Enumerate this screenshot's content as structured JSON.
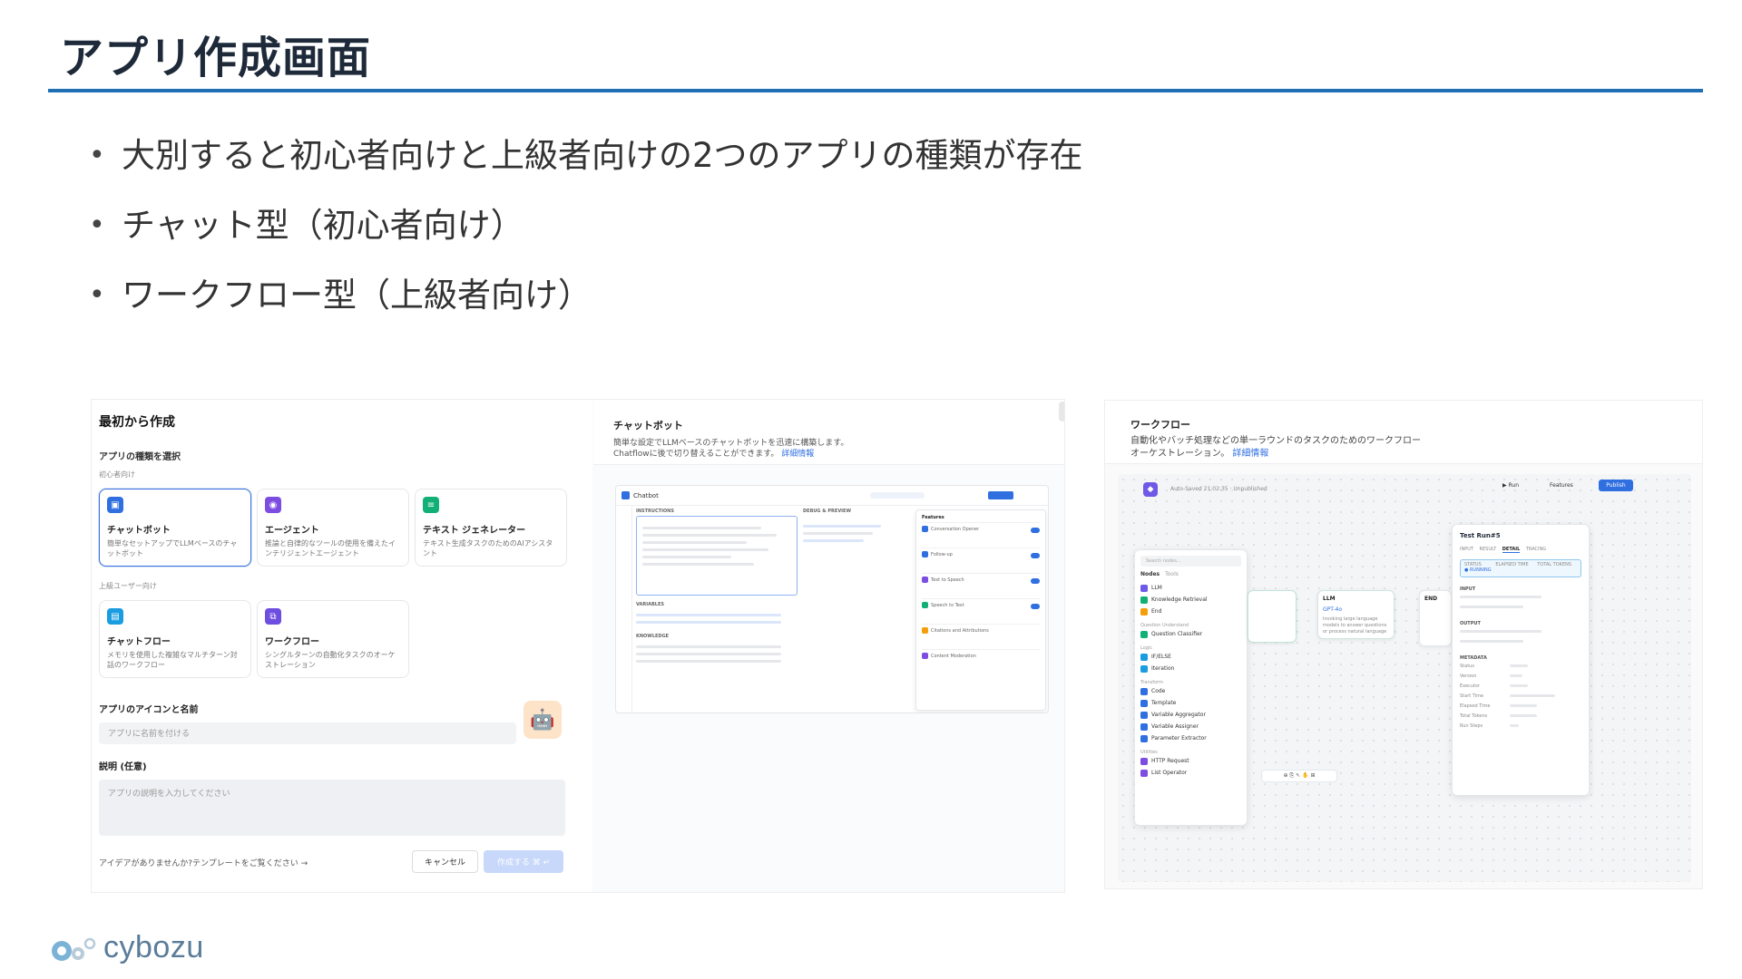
{
  "slide": {
    "title": "アプリ作成画面",
    "bullets": [
      "大別すると初心者向けと上級者向けの2つのアプリの種類が存在",
      "チャット型（初心者向け）",
      "ワークフロー型（上級者向け）"
    ],
    "logo_text": "cybozu",
    "colors": {
      "title_rule": "#1f6fb5",
      "accent": "#2f6fe0"
    }
  },
  "create_panel": {
    "title": "最初から作成",
    "type_label": "アプリの種類を選択",
    "beginner_group": "初心者向け",
    "advanced_group": "上級ユーザー向け",
    "cards": [
      {
        "name": "チャットボット",
        "desc": "簡単なセットアップでLLMベースのチャットボット",
        "icon": "chatbot-icon",
        "color": "#2f6fe0"
      },
      {
        "name": "エージェント",
        "desc": "推論と自律的なツールの使用を備えたインテリジェントエージェント",
        "icon": "agent-icon",
        "color": "#7c4de0"
      },
      {
        "name": "テキスト ジェネレーター",
        "desc": "テキスト生成タスクのためのAIアシスタント",
        "icon": "text-generator-icon",
        "color": "#12b076"
      },
      {
        "name": "チャットフロー",
        "desc": "メモリを使用した複雑なマルチターン対話のワークフロー",
        "icon": "chatflow-icon",
        "color": "#1a9ce0"
      },
      {
        "name": "ワークフロー",
        "desc": "シングルターンの自動化タスクのオーケストレーション",
        "icon": "workflow-icon",
        "color": "#6d4ee0"
      }
    ],
    "icon_name_label": "アプリのアイコンと名前",
    "name_placeholder": "アプリに名前を付ける",
    "desc_label": "説明 (任意)",
    "desc_placeholder": "アプリの説明を入力してください",
    "footer_text": "アイデアがありませんか?テンプレートをご覧ください →",
    "cancel": "キャンセル",
    "create": "作成する ⌘ ↵"
  },
  "chat_preview": {
    "title": "チャットボット",
    "desc_line1": "簡単な設定でLLMベースのチャットボットを迅速に構築します。",
    "desc_line2": "Chatflowに後で切り替えることができます。",
    "link": "詳細情報",
    "mock_app_name": "Chatbot",
    "instructions": "INSTRUCTIONS",
    "variables": "VARIABLES",
    "knowledge": "KNOWLEDGE",
    "debug": "DEBUG & PREVIEW",
    "features": "Features",
    "feature_items": [
      "Conversation Opener",
      "Follow-up",
      "Text to Speech",
      "Speech to Text",
      "Citations and Attributions",
      "Content Moderation"
    ]
  },
  "workflow_preview": {
    "title": "ワークフロー",
    "desc_line1": "自動化やバッチ処理などの単一ラウンドのタスクのためのワークフロー",
    "desc_line2": "オーケストレーション。",
    "link": "詳細情報",
    "autosave": "Auto-Saved 21:02:35 · Unpublished",
    "run": "Run",
    "features": "Features",
    "publish": "Publish",
    "search_placeholder": "Search nodes...",
    "tabs": [
      "Nodes",
      "Tools"
    ],
    "node_list": [
      {
        "group": "",
        "items": [
          "LLM",
          "Knowledge Retrieval",
          "End"
        ]
      },
      {
        "group": "Question Understand",
        "items": [
          "Question Classifier"
        ]
      },
      {
        "group": "Logic",
        "items": [
          "IF/ELSE",
          "Iteration"
        ]
      },
      {
        "group": "Transform",
        "items": [
          "Code",
          "Template",
          "Variable Aggregator",
          "Variable Assigner",
          "Parameter Extractor"
        ]
      },
      {
        "group": "Utilities",
        "items": [
          "HTTP Request",
          "List Operator"
        ]
      }
    ],
    "llm_node": "LLM",
    "llm_model": "GPT-4o",
    "llm_desc": "Invoking large language models to answer questions or process natural language",
    "end_node": "END",
    "detail": {
      "title": "Test Run#5",
      "tabs": [
        "INPUT",
        "RESULT",
        "DETAIL",
        "TRACING"
      ],
      "status_label": "STATUS",
      "status_value": "RUNNING",
      "elapsed": "ELAPSED TIME",
      "tokens": "TOTAL TOKENS",
      "input": "INPUT",
      "output": "OUTPUT",
      "metadata": "METADATA",
      "meta_rows": [
        "Status",
        "Version",
        "Executor",
        "Start Time",
        "Elapsed Time",
        "Total Tokens",
        "Run Steps"
      ]
    }
  }
}
